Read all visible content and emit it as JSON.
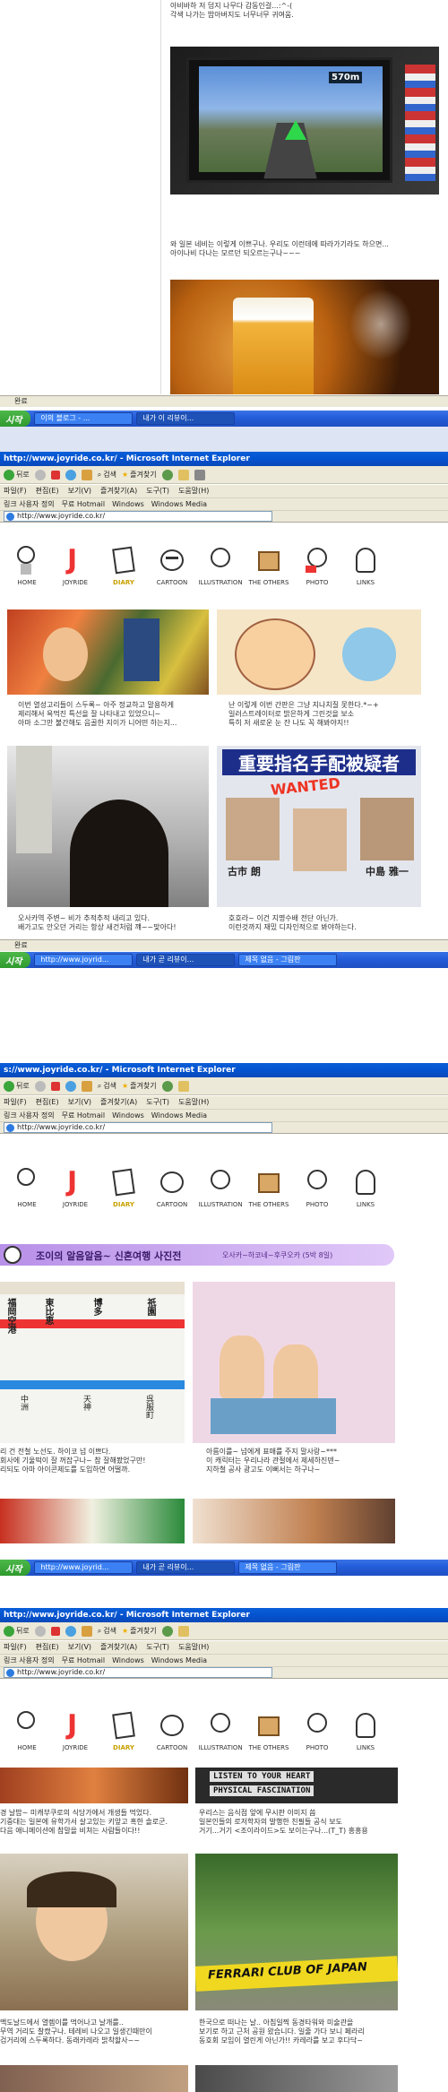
{
  "s1": {
    "caption1": "아비바하 저 덤지 나무다 감동인걸...:^-(\n각색 나가는 밥아버지도 너무너무 귀여움.",
    "navi_distance": "570m",
    "caption2": "와 일본 네비는 이렇게 이쁘구나. 우리도 이런데에 따라가기라도 하으면...\n아이나비 다나는 모르던 되오르는구나~~~",
    "status": "완료"
  },
  "taskbar1": {
    "start": "시작",
    "task1": "이의 블로그 - ...",
    "task2": "내가 이 리뷰이..."
  },
  "ie": {
    "title": "http://www.joyride.co.kr/ - Microsoft Internet Explorer",
    "menu": [
      "파일(F)",
      "편집(E)",
      "보기(V)",
      "즐겨찾기(A)",
      "도구(T)",
      "도움말(H)"
    ],
    "back": "뒤로",
    "search": "검색",
    "favorites": "즐겨찾기",
    "links": [
      "링크 사용자 정의",
      "무료 Hotmail",
      "Windows",
      "Windows Media"
    ],
    "address": "http://www.joyride.co.kr/",
    "nav": [
      "HOME",
      "JOYRIDE",
      "DIARY",
      "CARTOON",
      "ILLUSTRATION",
      "THE OTHERS",
      "PHOTO",
      "LINKS"
    ],
    "status": "완료"
  },
  "s2": {
    "cap1": "이번 열성고리들이 스두록~ 아주 정교하고 말용하게\n제리해서 욕먹진 특선을 잘 나타내고 있었으니~\n아마 소그만 불간해도 음골한 지이가 니어떤 하는지...",
    "cap2": "난 이렇게 이번 간판은 그냥 지나치질 못한다.*~+\n일러스트레이터로 밝은하게 그린것을 보소\n특히 저 새로운 눈 잔 나도 꼭 해봐야지!!",
    "cap3": "오사카역 주변~ 비가 추적추적 내리고 있다.\n배가고도 안오던 거리는 항상 새건처럼 꺠~~맞아다!",
    "cap4": "호호라~ 이건 지명수배 전단 아닌가.\n이런것까지 재밌 디자인적으로 봐야하는다.",
    "poster_title": "重要指名手配被疑者",
    "poster_wanted": "WANTED",
    "poster_name1": "古市 朗",
    "poster_name2": "中島 雅一"
  },
  "taskbar2": {
    "start": "시작",
    "task1": "http://www.joyrid...",
    "task2": "내가 곧 리뷰이...",
    "task3": "제목 없음 - 그림판"
  },
  "s3": {
    "title_url": "s://www.joyride.co.kr/ - Microsoft Internet Explorer",
    "banner": "조이의 알음알음~ 신혼여행 사진전",
    "banner_sub": "오사카~하코네~후쿠오카 (5박 8일)",
    "cap1": "리 건 전철 노선도. 하이코 넘 이쁘다.\n회사에 기울떡이 잘 꺼잡구나~ 참 잘해봤었구만!\n리되도 아마 아이콘제도를 도입하면 어떨까.",
    "cap2": "아름이를~ 넘에게 표매를 주지 말사랑~***\n이 캐릭터는 우리나라 관절에서 제세하진덴~\n지하철 공사 광고도 이뻐서는 하구나~",
    "sign_kanji": [
      "福岡空港",
      "東比恵",
      "博多",
      "祇園",
      "中洲",
      "天神",
      "呉服町"
    ]
  },
  "taskbar3": {
    "start": "시작",
    "task1": "http://www.joyrid...",
    "task2": "내가 곧 리뷰이...",
    "task3": "제목 없음 - 그림판"
  },
  "s4": {
    "sign_line1": "LISTEN TO YOUR HEART",
    "sign_line2": "PHYSICAL FASCINATION",
    "cap1": "경 날밥~ 미캐부쿠로의 식당가에서 개생들 먹었다.\n기중대는 일본에 유학가서 살고있는 키앞고 혹한 솔로군.\n다음 애니메이션에 참말을 비쳐는 사람들이다!!",
    "cap2": "우리스는 음식점 앞에 무시판 이미지 씀\n일본인들의 로저학자의 발행한 친필들 공식 보도\n거기...거기 <조이라이드>도 보이는구나...(T_T) 흥흥용",
    "cap3": "맥도날드에서 열렘이를 먹어나고 날개를..\n무역 거리도 찰캤구나. 테레비 나오고 일생긴때만이\n검거리에 스두록하다. 동래카레라 밝착할사~~",
    "cap4": "한국으로 떠나는 날.. 아침일찍 동경타워와 미술관을\n보기로 하고 근처 공원 왔습니다. 일줄 가다 보니 페라리\n동호회 모임이 열린게 아닌가!! 카레라를 보고 후다닥~",
    "ferrari": "FERRARI CLUB OF JAPAN"
  },
  "colors": {
    "xp_blue": "#0453d0",
    "xp_taskbar": "#245edb",
    "xp_start_green": "#2f9a2e",
    "chrome_beige": "#ece9d8",
    "banner_purple": "#d8b8f0",
    "diary_label": "#c8a000"
  }
}
